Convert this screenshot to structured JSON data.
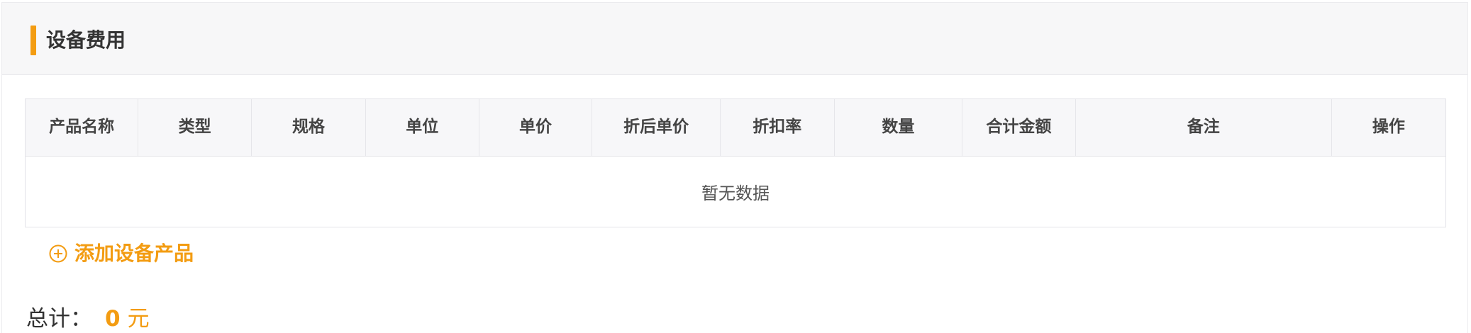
{
  "section": {
    "title": "设备费用"
  },
  "table": {
    "columns": [
      {
        "key": "name",
        "label": "产品名称"
      },
      {
        "key": "type",
        "label": "类型"
      },
      {
        "key": "spec",
        "label": "规格"
      },
      {
        "key": "unit",
        "label": "单位"
      },
      {
        "key": "price",
        "label": "单价"
      },
      {
        "key": "discount_price",
        "label": "折后单价"
      },
      {
        "key": "discount_rate",
        "label": "折扣率"
      },
      {
        "key": "quantity",
        "label": "数量"
      },
      {
        "key": "amount",
        "label": "合计金额"
      },
      {
        "key": "remark",
        "label": "备注"
      },
      {
        "key": "actions",
        "label": "操作"
      }
    ],
    "rows": [],
    "empty_text": "暂无数据"
  },
  "actions": {
    "add_label": "添加设备产品",
    "add_icon": "plus-circle-icon"
  },
  "summary": {
    "label": "总计：",
    "value": "0",
    "unit": "元"
  },
  "colors": {
    "accent": "#f39c12",
    "header_bg": "#f7f7f8"
  }
}
